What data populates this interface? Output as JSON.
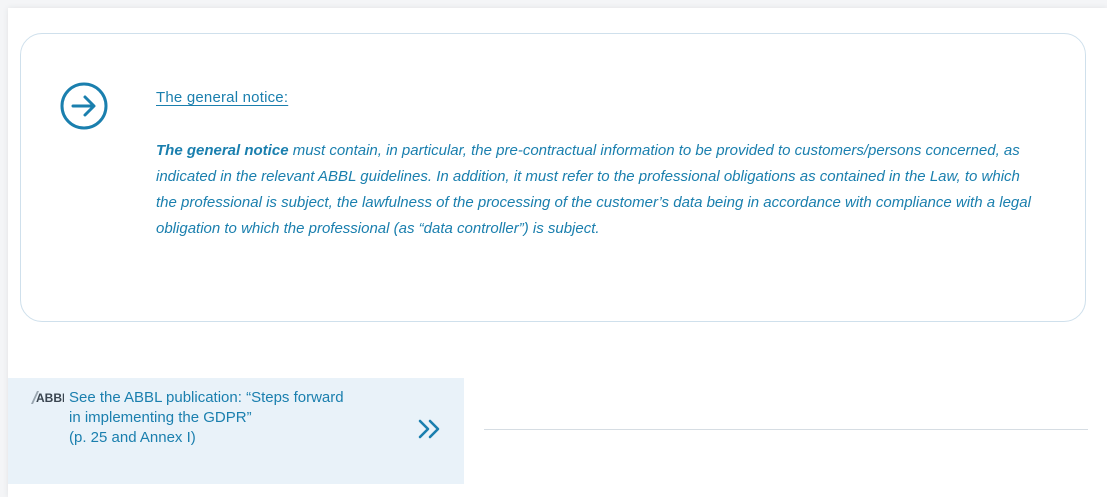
{
  "notice": {
    "heading": "The general notice:",
    "body_strong": "The general notice",
    "body_text": " must contain, in particular, the pre-contractual information to be provided to customers/persons concerned, as indicated in the relevant ABBL guidelines. In addition, it must refer to the professional obligations as contained in the Law, to which the professional is subject, the lawfulness of the processing of the customer’s data being in accordance with compliance with a legal obligation to which the professional (as “data controller”) is subject."
  },
  "publication": {
    "logo_text": "ABBL",
    "line1": "See the ABBL publication: “Steps forward",
    "line2": "in implementing the GDPR”",
    "line3": "(p. 25 and Annex I)"
  },
  "icons": {
    "notice": "arrow-right-circle-icon",
    "publication": "double-chevron-right-icon",
    "logo": "abbl-logo"
  },
  "colors": {
    "accent": "#1a7fae",
    "card_border": "#cfe0ec",
    "publication_bg": "#e9f2f9",
    "divider": "#d6dde3"
  }
}
